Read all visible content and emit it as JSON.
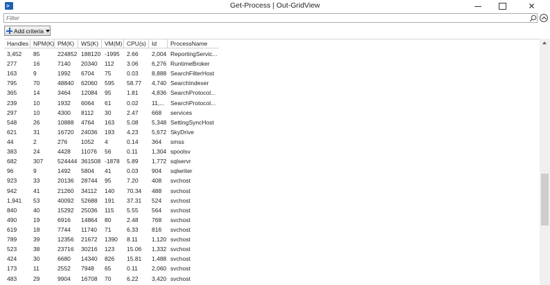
{
  "window": {
    "title": "Get-Process | Out-GridView",
    "icon": "powershell-icon",
    "close_glyph": "✕"
  },
  "filter": {
    "placeholder": "Filter",
    "value": ""
  },
  "toolbar": {
    "add_criteria_label": "Add criteria"
  },
  "grid": {
    "columns": [
      "Handles",
      "NPM(K)",
      "PM(K)",
      "WS(K)",
      "VM(M)",
      "CPU(s)",
      "Id",
      "ProcessName"
    ],
    "rows": [
      [
        "3,452",
        "85",
        "224852",
        "188120",
        "-1995",
        "2.66",
        "2,004",
        "ReportingServic..."
      ],
      [
        "277",
        "16",
        "7140",
        "20340",
        "112",
        "3.06",
        "6,276",
        "RuntimeBroker"
      ],
      [
        "163",
        "9",
        "1992",
        "6704",
        "75",
        "0.03",
        "8,888",
        "SearchFilterHost"
      ],
      [
        "795",
        "70",
        "48840",
        "62060",
        "595",
        "58.77",
        "4,740",
        "SearchIndexer"
      ],
      [
        "365",
        "14",
        "3464",
        "12084",
        "95",
        "1.81",
        "4,836",
        "SearchProtocol..."
      ],
      [
        "239",
        "10",
        "1932",
        "6064",
        "61",
        "0.02",
        "11,...",
        "SearchProtocol..."
      ],
      [
        "297",
        "10",
        "4300",
        "8112",
        "30",
        "2.47",
        "668",
        "services"
      ],
      [
        "548",
        "26",
        "10888",
        "4764",
        "163",
        "5.08",
        "5,348",
        "SettingSyncHost"
      ],
      [
        "621",
        "31",
        "16720",
        "24036",
        "193",
        "4.23",
        "5,672",
        "SkyDrive"
      ],
      [
        "44",
        "2",
        "276",
        "1052",
        "4",
        "0.14",
        "364",
        "smss"
      ],
      [
        "383",
        "24",
        "4428",
        "11076",
        "56",
        "0.11",
        "1,304",
        "spoolsv"
      ],
      [
        "682",
        "307",
        "524444",
        "361508",
        "-1878",
        "5.89",
        "1,772",
        "sqlservr"
      ],
      [
        "96",
        "9",
        "1492",
        "5804",
        "41",
        "0.03",
        "904",
        "sqlwriter"
      ],
      [
        "923",
        "33",
        "20136",
        "28744",
        "95",
        "7.20",
        "408",
        "svchost"
      ],
      [
        "942",
        "41",
        "21260",
        "34112",
        "140",
        "70.34",
        "488",
        "svchost"
      ],
      [
        "1,941",
        "53",
        "40092",
        "52688",
        "191",
        "37.31",
        "524",
        "svchost"
      ],
      [
        "840",
        "40",
        "15292",
        "25036",
        "115",
        "5.55",
        "564",
        "svchost"
      ],
      [
        "490",
        "19",
        "6916",
        "14864",
        "80",
        "2.48",
        "768",
        "svchost"
      ],
      [
        "619",
        "18",
        "7744",
        "11740",
        "71",
        "6.33",
        "816",
        "svchost"
      ],
      [
        "789",
        "39",
        "12356",
        "21672",
        "1390",
        "8.11",
        "1,120",
        "svchost"
      ],
      [
        "523",
        "38",
        "23716",
        "30216",
        "123",
        "15.06",
        "1,332",
        "svchost"
      ],
      [
        "424",
        "30",
        "6680",
        "14340",
        "826",
        "15.81",
        "1,488",
        "svchost"
      ],
      [
        "173",
        "11",
        "2552",
        "7948",
        "65",
        "0.11",
        "2,060",
        "svchost"
      ],
      [
        "483",
        "29",
        "9904",
        "16708",
        "70",
        "6.22",
        "3,420",
        "svchost"
      ]
    ]
  }
}
